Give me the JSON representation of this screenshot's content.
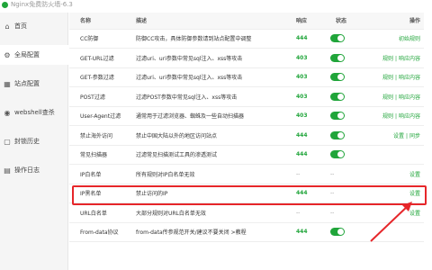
{
  "app": {
    "title": "Nginx免费防火墙-6.3"
  },
  "sidebar": {
    "items": [
      {
        "label": "首页",
        "icon": "home-icon",
        "active": false
      },
      {
        "label": "全局配置",
        "icon": "gear-icon",
        "active": true
      },
      {
        "label": "站点配置",
        "icon": "sites-icon",
        "active": false
      },
      {
        "label": "webshell查杀",
        "icon": "shield-icon",
        "active": false
      },
      {
        "label": "封锁历史",
        "icon": "history-icon",
        "active": false
      },
      {
        "label": "操作日志",
        "icon": "log-icon",
        "active": false
      }
    ]
  },
  "table": {
    "headers": {
      "name": "名称",
      "desc": "描述",
      "resp": "响应",
      "status": "状态",
      "action": "操作"
    },
    "rows": [
      {
        "name": "CC防御",
        "desc": "防御CC攻击，具体防御参数请到站点配置中调整",
        "resp": "444",
        "status": "on",
        "actions": [
          "初始规则"
        ]
      },
      {
        "name": "GET-URL过滤",
        "desc": "过滤uri、uri参数中常见sql注入、xss等攻击",
        "resp": "403",
        "status": "on",
        "actions": [
          "规则",
          "响应内容"
        ]
      },
      {
        "name": "GET-参数过滤",
        "desc": "过滤uri、uri参数中常见sql注入、xss等攻击",
        "resp": "403",
        "status": "on",
        "actions": [
          "规则",
          "响应内容"
        ]
      },
      {
        "name": "POST过滤",
        "desc": "过滤POST参数中常见sql注入、xss等攻击",
        "resp": "403",
        "status": "on",
        "actions": [
          "规则",
          "响应内容"
        ]
      },
      {
        "name": "User-Agent过滤",
        "desc": "通常用于过滤浏览器、蜘蛛及一些自动扫描器",
        "resp": "403",
        "status": "on",
        "actions": [
          "规则",
          "响应内容"
        ]
      },
      {
        "name": "禁止海外访问",
        "desc": "禁止中国大陆以外的地区访问站点",
        "resp": "444",
        "status": "on",
        "actions": [
          "设置",
          "同步"
        ]
      },
      {
        "name": "常见扫描器",
        "desc": "过滤常见扫描测试工具的渗透测试",
        "resp": "444",
        "status": "on",
        "actions": []
      },
      {
        "name": "IP白名单",
        "desc": "所有规则对IP白名单无效",
        "resp": "--",
        "status": "--",
        "actions": [
          "设置"
        ]
      },
      {
        "name": "IP黑名单",
        "desc": "禁止访问的IP",
        "resp": "444",
        "status": "--",
        "actions": [
          "设置"
        ]
      },
      {
        "name": "URL白名单",
        "desc": "大部分规则对URL白名单无效",
        "resp": "--",
        "status": "--",
        "actions": [
          "设置"
        ]
      },
      {
        "name": "From-data协议",
        "desc": "from-data传参规范开关/建议不要关闭 >教程",
        "resp": "444",
        "status": "on",
        "actions": []
      }
    ]
  },
  "colors": {
    "accent": "#20a53a",
    "highlight": "#e6262a"
  }
}
